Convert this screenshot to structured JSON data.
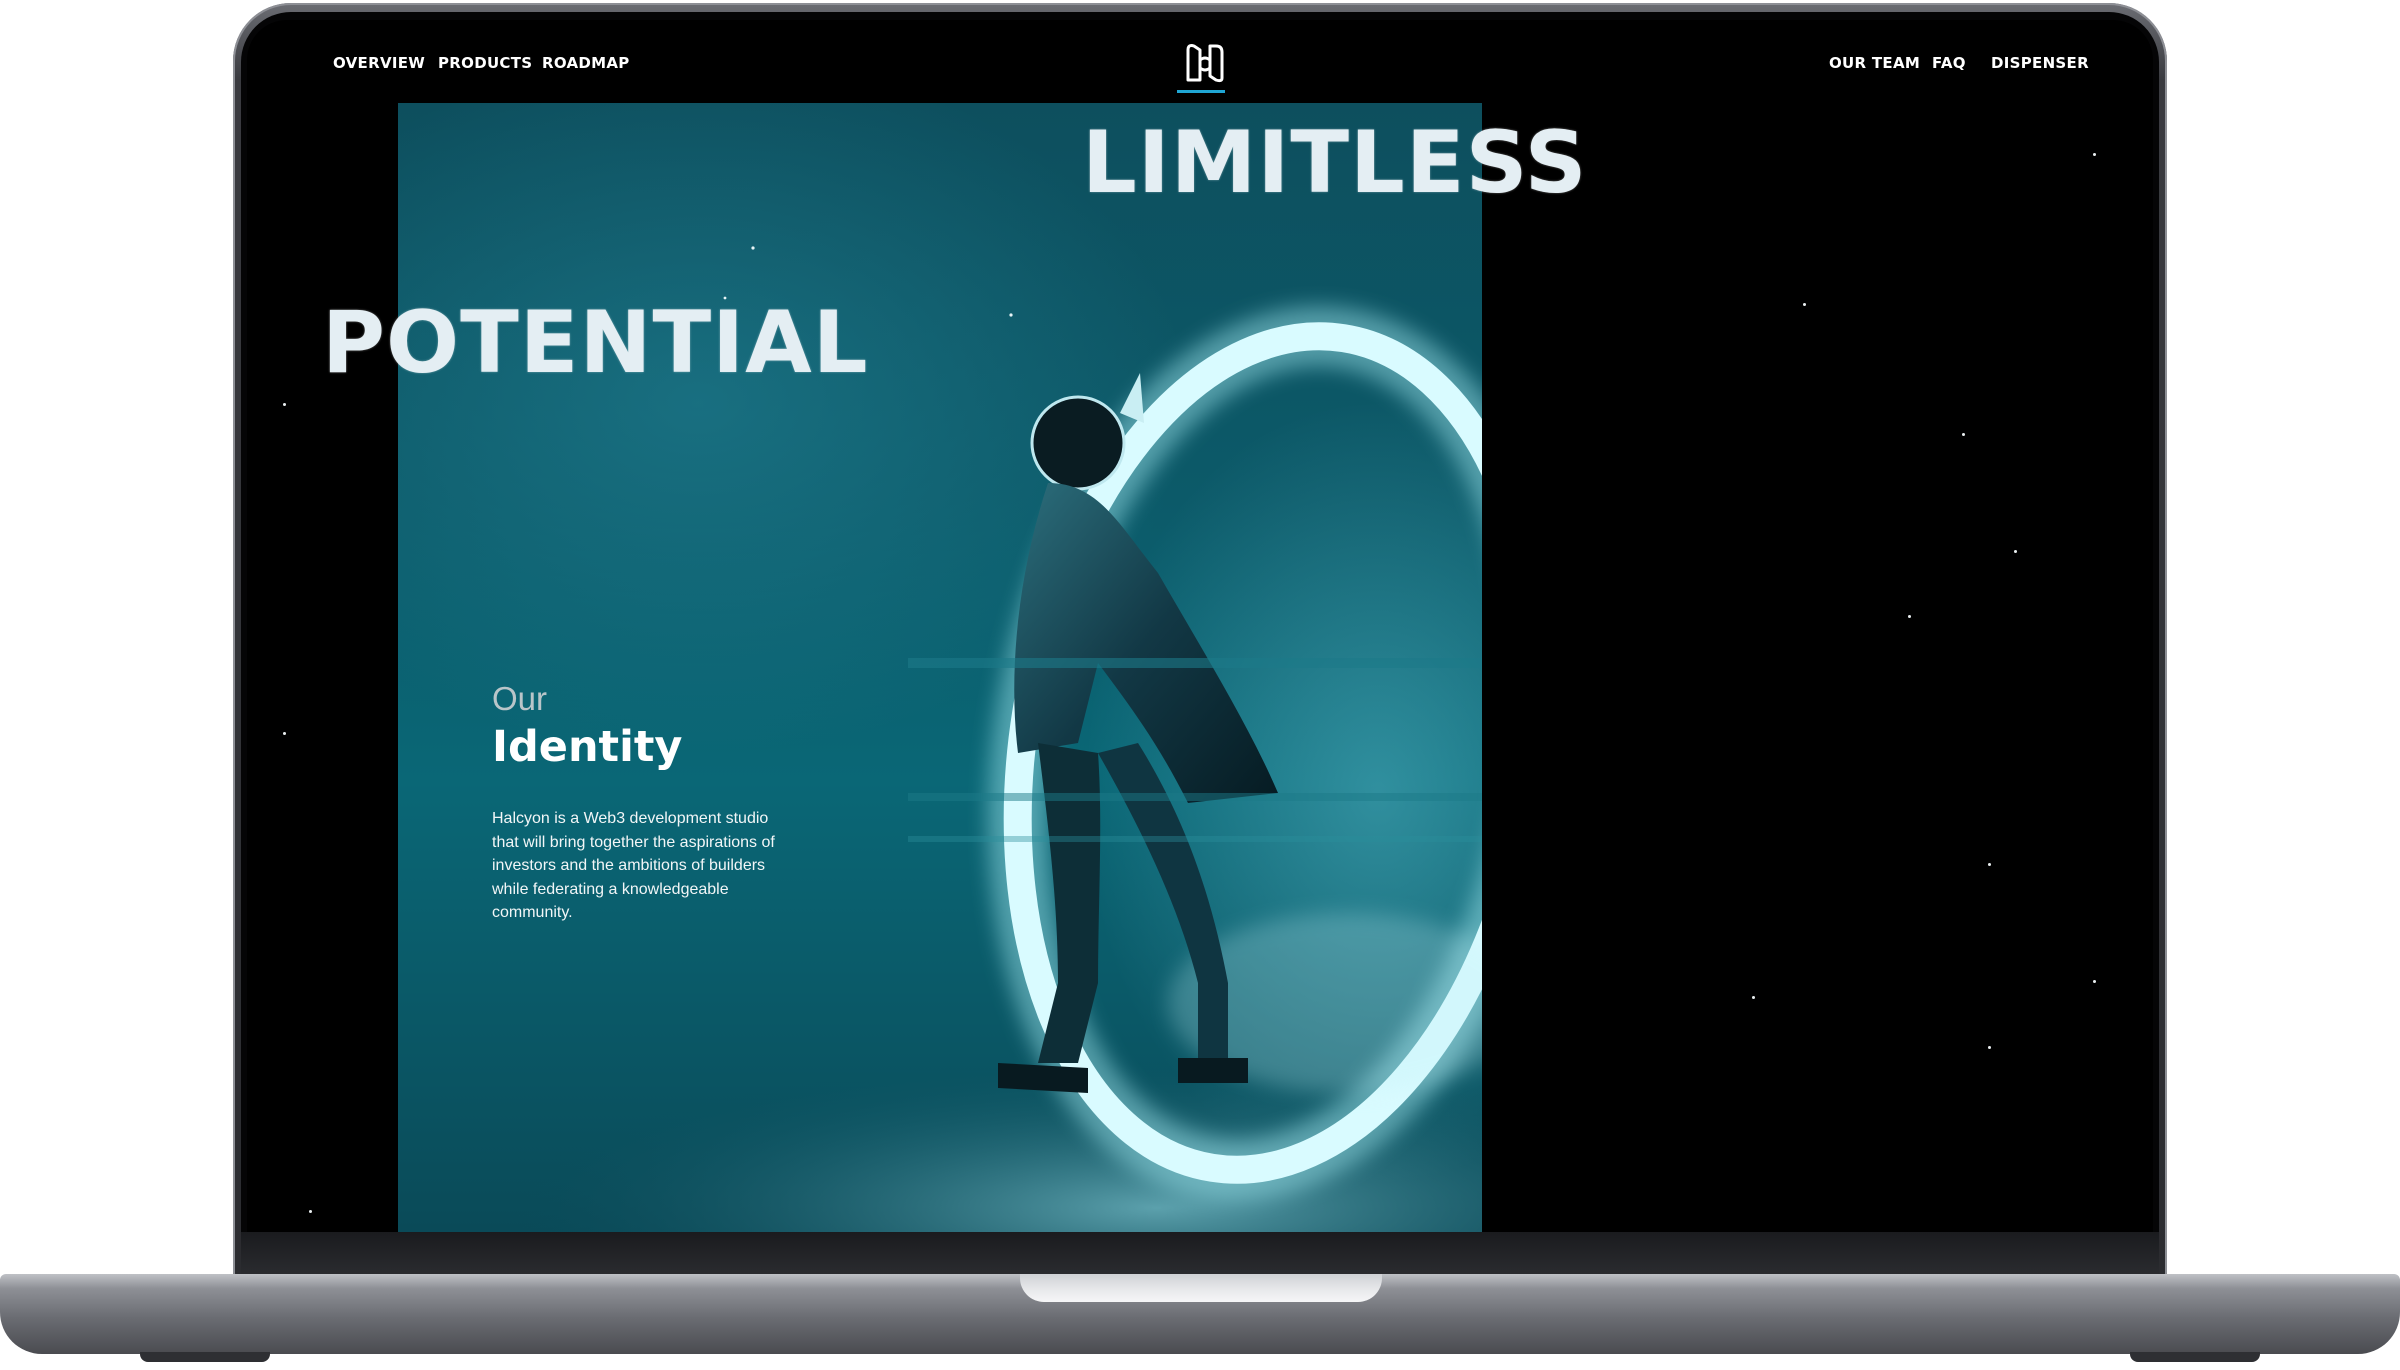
{
  "nav": {
    "left": [
      "OVERVIEW",
      "PRODUCTS",
      "ROADMAP"
    ],
    "right": [
      "OUR TEAM",
      "FAQ",
      "DISPENSER"
    ],
    "logo_icon": "halcyon-logo-icon"
  },
  "hero": {
    "headline_top": "LIMITLESS",
    "headline_bottom": "POTENTIAL"
  },
  "identity": {
    "label_small": "Our",
    "label_big": "Identity",
    "description": "Halcyon is a Web3 development studio that will bring together the aspirations of investors and the ambitions of builders while federating a knowledgeable community."
  },
  "colors": {
    "background": "#000000",
    "accent": "#1fa6d4",
    "art_teal": "#0c5a69",
    "text": "#ffffff"
  }
}
